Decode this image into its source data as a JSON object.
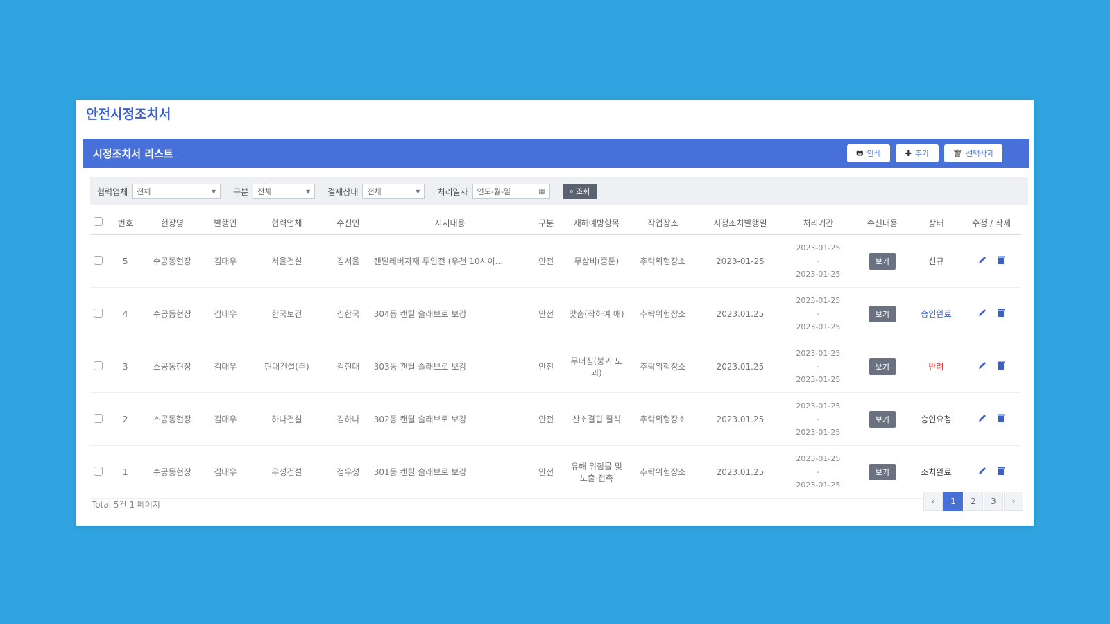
{
  "page_title": "안전시정조치서",
  "panel": {
    "title": "시정조치서 리스트",
    "buttons": {
      "print": "인쇄",
      "add": "추가",
      "delete_selected": "선택삭제"
    }
  },
  "filters": {
    "company_label": "협력업체",
    "company_value": "전체",
    "type_label": "구분",
    "type_value": "전체",
    "status_label": "결재상태",
    "status_value": "전체",
    "date_label": "처리일자",
    "date_value": "연도-월-일",
    "search_label": "조회"
  },
  "columns": [
    "번호",
    "현장명",
    "발행인",
    "협력업체",
    "수신인",
    "지시내용",
    "구분",
    "재해예방항목",
    "작업장소",
    "시정조치발행일",
    "처리기간",
    "수신내용",
    "상태",
    "수정 / 삭제"
  ],
  "rows": [
    {
      "no": "5",
      "site": "수공동현장",
      "issuer": "김대우",
      "company": "서울건설",
      "receiver": "김서울",
      "subject": "캔틸레버자재 투입전 (우천 10시이...",
      "type": "안전",
      "hazard": "무상비(중둔)",
      "place": "추락위험장소",
      "issued": "2023-01-25",
      "period_from": "2023-01-25",
      "period_sep": "-",
      "period_to": "2023-01-25",
      "view": "보기",
      "status": "신규"
    },
    {
      "no": "4",
      "site": "수공동현장",
      "issuer": "김대우",
      "company": "한국토건",
      "receiver": "김한국",
      "subject": "304동 캔틸 슬래브로 보강",
      "type": "안전",
      "hazard": "맞춤(작하여 애)",
      "place": "추락위험장소",
      "issued": "2023.01.25",
      "period_from": "2023-01-25",
      "period_sep": "-",
      "period_to": "2023-01-25",
      "view": "보기",
      "status": "승인완료"
    },
    {
      "no": "3",
      "site": "스공동현장",
      "issuer": "김대우",
      "company": "현대건설(주)",
      "receiver": "김현대",
      "subject": "303동 캔틸 슬래브로 보강",
      "type": "안전",
      "hazard": "무너짐(붕괴 도괴)",
      "place": "추락위험장소",
      "issued": "2023.01.25",
      "period_from": "2023-01-25",
      "period_sep": "-",
      "period_to": "2023-01-25",
      "view": "보기",
      "status": "반려"
    },
    {
      "no": "2",
      "site": "스공동현장",
      "issuer": "김대우",
      "company": "하나건설",
      "receiver": "김하나",
      "subject": "302동 캔틸 슬래브로 보강",
      "type": "안전",
      "hazard": "산소결핍 질식",
      "place": "추락위험장소",
      "issued": "2023.01.25",
      "period_from": "2023-01-25",
      "period_sep": "-",
      "period_to": "2023-01-25",
      "view": "보기",
      "status": "승인요청"
    },
    {
      "no": "1",
      "site": "수공동현장",
      "issuer": "김대우",
      "company": "우성건설",
      "receiver": "정우성",
      "subject": "301동 캔틸 슬래브로 보강",
      "type": "안전",
      "hazard": "유해 위험물 및 노출·접촉",
      "place": "추락위험장소",
      "issued": "2023.01.25",
      "period_from": "2023-01-25",
      "period_sep": "-",
      "period_to": "2023-01-25",
      "view": "보기",
      "status": "조치완료"
    }
  ],
  "status_colors": {
    "신규": "#555555",
    "승인완료": "#3b5fc8",
    "반려": "#e03a3a",
    "승인요청": "#444444",
    "조치완료": "#444444"
  },
  "footer": {
    "total": "Total 5건 1 페이지"
  },
  "pagination": {
    "prev": "‹",
    "pages": [
      "1",
      "2",
      "3"
    ],
    "next": "›",
    "current": "1"
  },
  "icons": {
    "print": "printer-icon",
    "add": "plus-icon",
    "delete": "trash-icon",
    "search": "search-icon",
    "edit": "pencil-icon",
    "calendar": "calendar-icon",
    "caret": "chevron-down-icon"
  }
}
